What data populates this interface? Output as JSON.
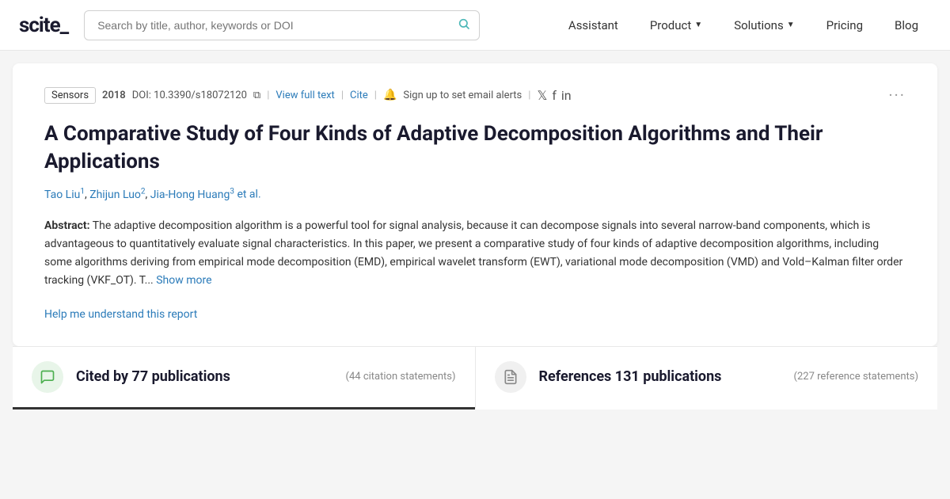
{
  "navbar": {
    "logo": "scite_",
    "search_placeholder": "Search by title, author, keywords or DOI",
    "nav_items": [
      {
        "label": "Assistant",
        "has_chevron": false
      },
      {
        "label": "Product",
        "has_chevron": true
      },
      {
        "label": "Solutions",
        "has_chevron": true
      },
      {
        "label": "Pricing",
        "has_chevron": false
      },
      {
        "label": "Blog",
        "has_chevron": false
      }
    ]
  },
  "paper": {
    "journal": "Sensors",
    "year": "2018",
    "doi": "DOI: 10.3390/s18072120",
    "view_full_text": "View full text",
    "cite": "Cite",
    "sign_up": "Sign up to set email alerts",
    "title": "A Comparative Study of Four Kinds of Adaptive Decomposition Algorithms and Their Applications",
    "authors": [
      {
        "name": "Tao Liu",
        "superscript": "1"
      },
      {
        "name": "Zhijun Luo",
        "superscript": "2"
      },
      {
        "name": "Jia-Hong Huang",
        "superscript": "3"
      }
    ],
    "et_al": "et al.",
    "abstract_label": "Abstract:",
    "abstract_text": "The adaptive decomposition algorithm is a powerful tool for signal analysis, because it can decompose signals into several narrow-band components, which is advantageous to quantitatively evaluate signal characteristics. In this paper, we present a comparative study of four kinds of adaptive decomposition algorithms, including some algorithms deriving from empirical mode decomposition (EMD), empirical wavelet transform (EWT), variational mode decomposition (VMD) and Vold–Kalman filter order tracking (VKF_OT). T...",
    "show_more": "Show more",
    "help_link": "Help me understand this report"
  },
  "stats": {
    "cited_by_label": "Cited by 77 publications",
    "cited_by_sub": "(44 citation statements)",
    "references_label": "References 131 publications",
    "references_sub": "(227 reference statements)"
  }
}
